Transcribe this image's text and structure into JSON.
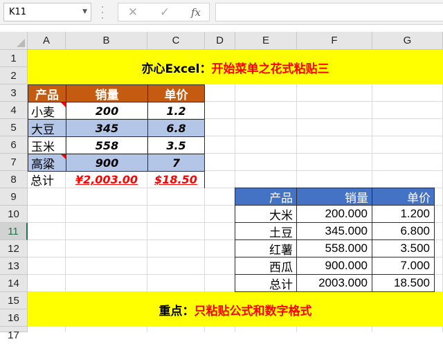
{
  "name_box": {
    "value": "K11",
    "dropdown_icon": "chevron-down-icon"
  },
  "formula_buttons": {
    "cancel": "✕",
    "enter": "✓",
    "fx": "fx"
  },
  "formula_input": {
    "value": ""
  },
  "columns": [
    "A",
    "B",
    "C",
    "D",
    "E",
    "F",
    "G"
  ],
  "rows": [
    "1",
    "2",
    "3",
    "4",
    "5",
    "6",
    "7",
    "8",
    "9",
    "10",
    "11",
    "12",
    "13",
    "14",
    "15",
    "16",
    "17"
  ],
  "active_row": "11",
  "title_band": {
    "lead": "亦心Excel：",
    "highlight": "开始菜单之花式粘贴三"
  },
  "footer_band": {
    "lead": "重点：",
    "highlight": "只粘贴公式和数字格式"
  },
  "table1": {
    "headers": [
      "产品",
      "销量",
      "单价"
    ],
    "rows": [
      {
        "name": "小麦",
        "qty": "200",
        "price": "1.2"
      },
      {
        "name": "大豆",
        "qty": "345",
        "price": "6.8"
      },
      {
        "name": "玉米",
        "qty": "558",
        "price": "3.5"
      },
      {
        "name": "高粱",
        "qty": "900",
        "price": "7"
      }
    ],
    "total": {
      "label": "总计",
      "qty": "¥2,003.00",
      "price": "$18.50"
    },
    "colors": {
      "header": "#c55a11",
      "band": "#b4c6e7",
      "total_text": "#ff0000"
    }
  },
  "table2": {
    "headers": [
      "产品",
      "销量",
      "单价"
    ],
    "rows": [
      {
        "name": "大米",
        "qty": "200.000",
        "price": "1.200"
      },
      {
        "name": "土豆",
        "qty": "345.000",
        "price": "6.800"
      },
      {
        "name": "红薯",
        "qty": "558.000",
        "price": "3.500"
      },
      {
        "name": "西瓜",
        "qty": "900.000",
        "price": "7.000"
      }
    ],
    "total": {
      "label": "总计",
      "qty": "2003.000",
      "price": "18.500"
    },
    "colors": {
      "header": "#4472c4"
    }
  },
  "colors": {
    "band": "#ffff00",
    "highlight": "#ff0000",
    "excel_green": "#217346"
  }
}
